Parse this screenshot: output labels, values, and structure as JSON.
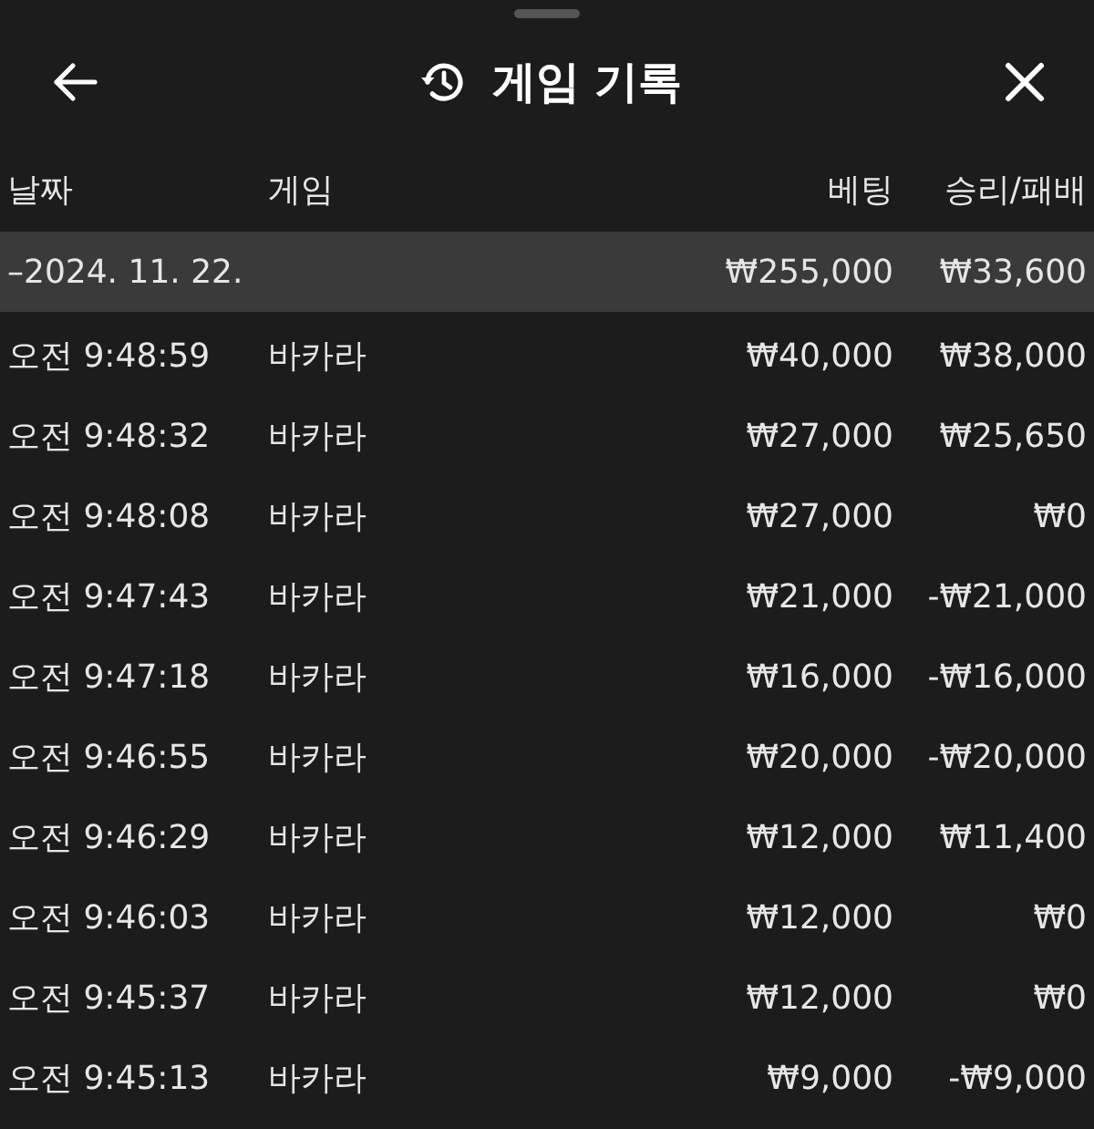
{
  "header": {
    "title": "게임 기록"
  },
  "table": {
    "columns": [
      "날짜",
      "게임",
      "베팅",
      "승리/패배"
    ],
    "group": {
      "date": "–2024. 11. 22.",
      "bet": "₩255,000",
      "result": "₩33,600"
    },
    "rows": [
      {
        "time": "오전 9:48:59",
        "game": "바카라",
        "bet": "₩40,000",
        "result": "₩38,000"
      },
      {
        "time": "오전 9:48:32",
        "game": "바카라",
        "bet": "₩27,000",
        "result": "₩25,650"
      },
      {
        "time": "오전 9:48:08",
        "game": "바카라",
        "bet": "₩27,000",
        "result": "₩0"
      },
      {
        "time": "오전 9:47:43",
        "game": "바카라",
        "bet": "₩21,000",
        "result": "-₩21,000"
      },
      {
        "time": "오전 9:47:18",
        "game": "바카라",
        "bet": "₩16,000",
        "result": "-₩16,000"
      },
      {
        "time": "오전 9:46:55",
        "game": "바카라",
        "bet": "₩20,000",
        "result": "-₩20,000"
      },
      {
        "time": "오전 9:46:29",
        "game": "바카라",
        "bet": "₩12,000",
        "result": "₩11,400"
      },
      {
        "time": "오전 9:46:03",
        "game": "바카라",
        "bet": "₩12,000",
        "result": "₩0"
      },
      {
        "time": "오전 9:45:37",
        "game": "바카라",
        "bet": "₩12,000",
        "result": "₩0"
      },
      {
        "time": "오전 9:45:13",
        "game": "바카라",
        "bet": "₩9,000",
        "result": "-₩9,000"
      }
    ]
  }
}
